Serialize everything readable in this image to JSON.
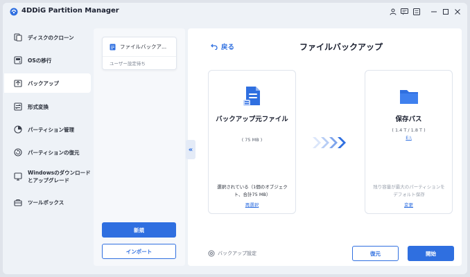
{
  "app": {
    "title": "4DDiG Partition Manager"
  },
  "sidebar": {
    "items": [
      {
        "label": "ディスクのクローン",
        "icon": "disk-clone-icon"
      },
      {
        "label": "OSの移行",
        "icon": "os-migrate-icon"
      },
      {
        "label": "バックアップ",
        "icon": "backup-icon",
        "active": true
      },
      {
        "label": "形式変換",
        "icon": "convert-icon"
      },
      {
        "label": "パーティション管理",
        "icon": "partition-manage-icon"
      },
      {
        "label": "パーティションの復元",
        "icon": "partition-recover-icon"
      },
      {
        "label": "Windowsのダウンロードとアップグレード",
        "icon": "windows-download-icon"
      },
      {
        "label": "ツールボックス",
        "icon": "toolbox-icon"
      }
    ]
  },
  "tasks": {
    "card": {
      "title": "ファイルバックア...",
      "status": "ユーザー設定待ち"
    },
    "new_label": "新規",
    "import_label": "インポート"
  },
  "main": {
    "back_label": "戻る",
    "title": "ファイルバックアップ",
    "source": {
      "title": "バックアップ元ファイル",
      "size": "( 75 MB )",
      "desc": "選択されている（1個のオブジェクト、合計75 MB）",
      "link": "再選択"
    },
    "destination": {
      "title": "保存パス",
      "size": "( 1.4 T / 1.8 T )",
      "drive": "E:\\",
      "desc": "残り容量が最大のパーティションをデフォルト保存",
      "link": "変更"
    },
    "settings_label": "バックアップ設定",
    "restore_label": "復元",
    "start_label": "開始"
  },
  "colors": {
    "accent": "#2f6fe0",
    "background": "#eef2f7"
  }
}
